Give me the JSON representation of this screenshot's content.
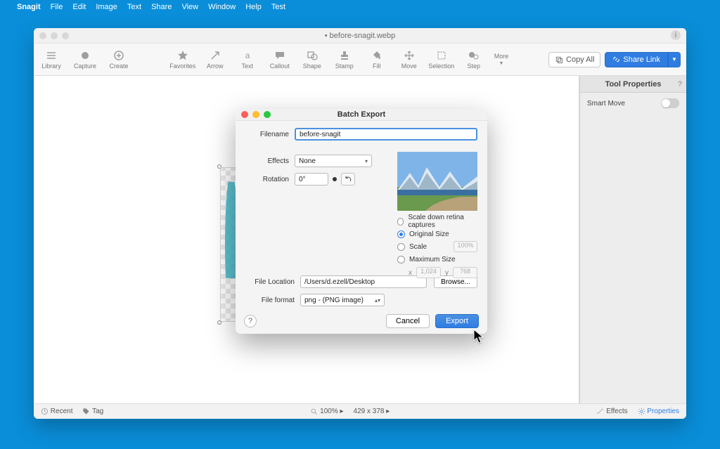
{
  "menubar": {
    "app": "Snagit",
    "items": [
      "File",
      "Edit",
      "Image",
      "Text",
      "Share",
      "View",
      "Window",
      "Help",
      "Test"
    ]
  },
  "window": {
    "title": "• before-snagit.webp"
  },
  "toolbar": {
    "left": [
      {
        "name": "hamburger-icon",
        "label": "Library"
      },
      {
        "name": "record-icon",
        "label": "Capture"
      },
      {
        "name": "plus-circle-icon",
        "label": "Create"
      }
    ],
    "center": [
      {
        "name": "star-icon",
        "label": "Favorites"
      },
      {
        "name": "arrow-icon",
        "label": "Arrow"
      },
      {
        "name": "text-a-icon",
        "label": "Text"
      },
      {
        "name": "callout-icon",
        "label": "Callout"
      },
      {
        "name": "shape-icon",
        "label": "Shape"
      },
      {
        "name": "stamp-icon",
        "label": "Stamp"
      },
      {
        "name": "fill-icon",
        "label": "Fill"
      },
      {
        "name": "move-icon",
        "label": "Move"
      },
      {
        "name": "selection-icon",
        "label": "Selection"
      },
      {
        "name": "step-icon",
        "label": "Step"
      }
    ],
    "more_label": "More",
    "copy_all": "Copy All",
    "share_link": "Share Link"
  },
  "properties": {
    "title": "Tool Properties",
    "smart_move": "Smart Move"
  },
  "status": {
    "recent": "Recent",
    "tag": "Tag",
    "zoom": "100% ▸",
    "dims": "429 x 378 ▸",
    "effects": "Effects",
    "properties": "Properties"
  },
  "modal": {
    "title": "Batch Export",
    "labels": {
      "filename": "Filename",
      "effects": "Effects",
      "rotation": "Rotation",
      "file_location": "File Location",
      "file_format": "File format"
    },
    "filename_value": "before-snagit",
    "effects_value": "None",
    "rotation_value": "0°",
    "scale_down": "Scale down retina captures",
    "original_size": "Original Size",
    "scale": "Scale",
    "scale_value": "100%",
    "max_size": "Maximum Size",
    "dim_x_label": "x",
    "dim_x": "1,024",
    "dim_y_label": "y",
    "dim_y": "768",
    "location_value": "/Users/d.ezell/Desktop",
    "browse": "Browse...",
    "format_value": "png - (PNG image)",
    "cancel": "Cancel",
    "export": "Export",
    "help": "?"
  }
}
